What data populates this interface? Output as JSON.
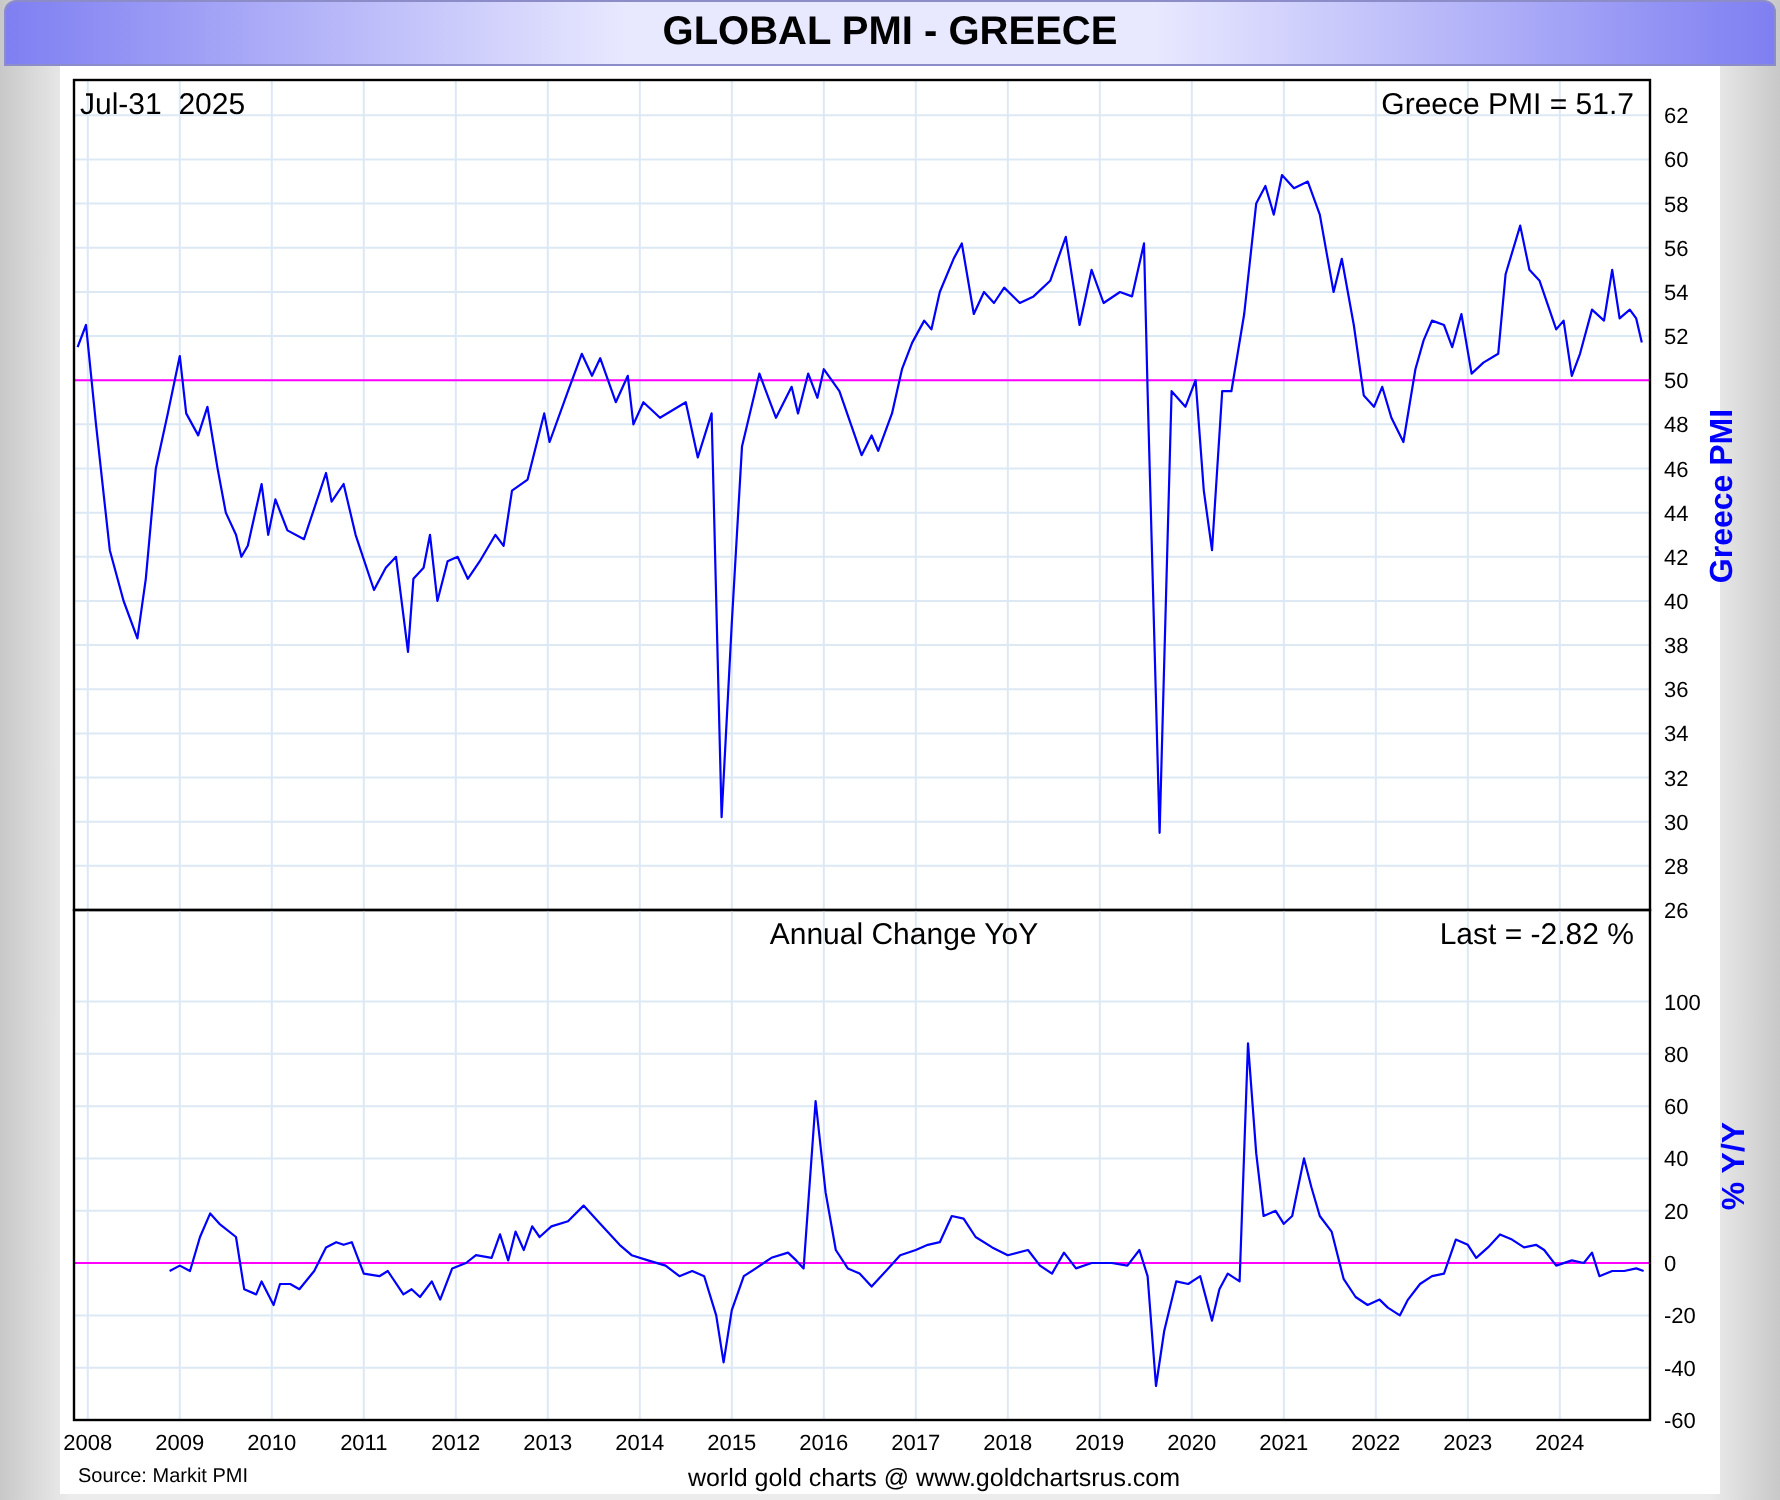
{
  "title": "GLOBAL PMI - GREECE",
  "date": "Jul-31  2025",
  "panels": [
    {
      "reading": "Greece PMI = 51.7",
      "chart_data": {
        "type": "line",
        "ylabel": "Greece PMI",
        "xlim": [
          2007.85,
          2024.98
        ],
        "ylim": [
          26,
          63.6
        ],
        "yticks": [
          26,
          28,
          30,
          32,
          34,
          36,
          38,
          40,
          42,
          44,
          46,
          48,
          50,
          52,
          54,
          56,
          58,
          60,
          62
        ],
        "grid": true,
        "ref_lines": [
          {
            "axis": "y",
            "value": 50,
            "color": "#ff00ff"
          }
        ],
        "x": [
          2007.89,
          2007.98,
          2008.09,
          2008.24,
          2008.39,
          2008.54,
          2008.63,
          2008.74,
          2008.87,
          2009.0,
          2009.07,
          2009.2,
          2009.3,
          2009.41,
          2009.5,
          2009.61,
          2009.67,
          2009.74,
          2009.89,
          2009.96,
          2010.04,
          2010.17,
          2010.35,
          2010.59,
          2010.65,
          2010.78,
          2010.91,
          2011.11,
          2011.24,
          2011.35,
          2011.48,
          2011.54,
          2011.65,
          2011.72,
          2011.8,
          2011.91,
          2012.02,
          2012.13,
          2012.26,
          2012.43,
          2012.52,
          2012.61,
          2012.78,
          2012.96,
          2013.02,
          2013.22,
          2013.37,
          2013.48,
          2013.57,
          2013.74,
          2013.87,
          2013.93,
          2014.04,
          2014.22,
          2014.5,
          2014.63,
          2014.78,
          2014.89,
          2015.0,
          2015.11,
          2015.3,
          2015.48,
          2015.65,
          2015.72,
          2015.83,
          2015.93,
          2016.0,
          2016.17,
          2016.41,
          2016.52,
          2016.59,
          2016.74,
          2016.85,
          2016.96,
          2017.09,
          2017.17,
          2017.26,
          2017.41,
          2017.5,
          2017.63,
          2017.74,
          2017.85,
          2017.96,
          2018.13,
          2018.28,
          2018.46,
          2018.63,
          2018.78,
          2018.91,
          2019.04,
          2019.22,
          2019.35,
          2019.48,
          2019.52,
          2019.65,
          2019.78,
          2019.93,
          2020.04,
          2020.13,
          2020.22,
          2020.33,
          2020.43,
          2020.57,
          2020.7,
          2020.8,
          2020.89,
          2020.98,
          2021.11,
          2021.26,
          2021.39,
          2021.54,
          2021.63,
          2021.76,
          2021.87,
          2021.98,
          2022.07,
          2022.17,
          2022.3,
          2022.43,
          2022.52,
          2022.61,
          2022.74,
          2022.83,
          2022.93,
          2023.04,
          2023.17,
          2023.33,
          2023.41,
          2023.57,
          2023.67,
          2023.78,
          2023.96,
          2024.04,
          2024.13,
          2024.22,
          2024.35,
          2024.48,
          2024.57,
          2024.65,
          2024.76,
          2024.83,
          2024.89
        ],
        "series": [
          {
            "color": "#0000ff",
            "values": [
              51.5,
              52.5,
              48,
              42.3,
              40,
              38.3,
              41,
              46,
              48.5,
              51.1,
              48.5,
              47.5,
              48.8,
              46,
              44,
              43,
              42,
              42.5,
              45.3,
              43,
              44.6,
              43.2,
              42.8,
              45.8,
              44.5,
              45.3,
              43,
              40.5,
              41.5,
              42,
              37.7,
              41,
              41.5,
              43,
              40,
              41.8,
              42,
              41,
              41.8,
              43,
              42.5,
              45,
              45.5,
              48.5,
              47.2,
              49.5,
              51.2,
              50.2,
              51,
              49,
              50.2,
              48,
              49,
              48.3,
              49,
              46.5,
              48.5,
              30.2,
              39,
              47,
              50.3,
              48.3,
              49.7,
              48.5,
              50.3,
              49.2,
              50.5,
              49.5,
              46.6,
              47.5,
              46.8,
              48.5,
              50.5,
              51.7,
              52.7,
              52.3,
              54,
              55.5,
              56.2,
              53,
              54,
              53.5,
              54.2,
              53.5,
              53.8,
              54.5,
              56.5,
              52.5,
              55,
              53.5,
              54,
              53.8,
              56.2,
              49.5,
              29.5,
              49.5,
              48.8,
              50,
              45,
              42.3,
              49.5,
              49.5,
              53,
              58,
              58.8,
              57.5,
              59.3,
              58.7,
              59,
              57.5,
              54,
              55.5,
              52.5,
              49.3,
              48.8,
              49.7,
              48.3,
              47.2,
              50.5,
              51.8,
              52.7,
              52.5,
              51.5,
              53,
              50.3,
              50.8,
              51.2,
              54.8,
              57,
              55,
              54.5,
              52.3,
              52.7,
              50.2,
              51.2,
              53.2,
              52.7,
              55,
              52.8,
              53.2,
              52.8,
              51.7
            ]
          }
        ]
      }
    },
    {
      "reading": "Last = -2.82 %",
      "chart_data": {
        "type": "line",
        "title": "Annual Change YoY",
        "ylabel": "% Y/Y",
        "xlim": [
          2007.85,
          2024.98
        ],
        "ylim": [
          -60,
          135
        ],
        "yticks": [
          -60,
          -40,
          -20,
          0,
          20,
          40,
          60,
          80,
          100
        ],
        "xticks": [
          2008,
          2009,
          2010,
          2011,
          2012,
          2013,
          2014,
          2015,
          2016,
          2017,
          2018,
          2019,
          2020,
          2021,
          2022,
          2023,
          2024
        ],
        "grid": true,
        "ref_lines": [
          {
            "axis": "y",
            "value": 0,
            "color": "#ff00ff"
          }
        ],
        "x": [
          2008.89,
          2009.0,
          2009.11,
          2009.22,
          2009.33,
          2009.43,
          2009.61,
          2009.7,
          2009.83,
          2009.89,
          2010.02,
          2010.09,
          2010.2,
          2010.3,
          2010.46,
          2010.59,
          2010.7,
          2010.78,
          2010.87,
          2011.0,
          2011.17,
          2011.26,
          2011.43,
          2011.52,
          2011.61,
          2011.74,
          2011.83,
          2011.96,
          2012.11,
          2012.22,
          2012.39,
          2012.48,
          2012.57,
          2012.65,
          2012.74,
          2012.83,
          2012.91,
          2013.04,
          2013.22,
          2013.39,
          2013.57,
          2013.78,
          2013.91,
          2014.09,
          2014.28,
          2014.43,
          2014.57,
          2014.7,
          2014.83,
          2014.91,
          2015.0,
          2015.13,
          2015.26,
          2015.43,
          2015.61,
          2015.7,
          2015.78,
          2015.91,
          2016.02,
          2016.13,
          2016.26,
          2016.39,
          2016.52,
          2016.65,
          2016.83,
          2017.0,
          2017.13,
          2017.26,
          2017.39,
          2017.52,
          2017.65,
          2017.83,
          2018.0,
          2018.22,
          2018.35,
          2018.48,
          2018.61,
          2018.74,
          2018.91,
          2019.13,
          2019.3,
          2019.43,
          2019.52,
          2019.61,
          2019.7,
          2019.83,
          2019.96,
          2020.09,
          2020.22,
          2020.3,
          2020.39,
          2020.52,
          2020.61,
          2020.7,
          2020.78,
          2020.91,
          2021.0,
          2021.09,
          2021.22,
          2021.3,
          2021.39,
          2021.52,
          2021.65,
          2021.78,
          2021.91,
          2022.04,
          2022.13,
          2022.26,
          2022.35,
          2022.48,
          2022.61,
          2022.74,
          2022.87,
          2023.0,
          2023.09,
          2023.22,
          2023.35,
          2023.48,
          2023.61,
          2023.74,
          2023.83,
          2023.96,
          2024.13,
          2024.26,
          2024.35,
          2024.43,
          2024.57,
          2024.7,
          2024.83,
          2024.91
        ],
        "series": [
          {
            "color": "#0000ff",
            "values": [
              -3,
              -1,
              -3,
              10,
              19,
              15,
              10,
              -10,
              -12,
              -7,
              -16,
              -8,
              -8,
              -10,
              -3,
              6,
              8,
              7,
              8,
              -4,
              -5,
              -3,
              -12,
              -10,
              -13,
              -7,
              -14,
              -2,
              0,
              3,
              2,
              11,
              1,
              12,
              5,
              14,
              10,
              14,
              16,
              22,
              15,
              7,
              3,
              1,
              -1,
              -5,
              -3,
              -5,
              -20,
              -38,
              -18,
              -5,
              -2,
              2,
              4,
              1,
              -2,
              62,
              27,
              5,
              -2,
              -4,
              -9,
              -4,
              3,
              5,
              7,
              8,
              18,
              17,
              10,
              6,
              3,
              5,
              -1,
              -4,
              4,
              -2,
              0,
              0,
              -1,
              5,
              -5,
              -47,
              -26,
              -7,
              -8,
              -5,
              -22,
              -10,
              -4,
              -7,
              84,
              42,
              18,
              20,
              15,
              18,
              40,
              29,
              18,
              12,
              -6,
              -13,
              -16,
              -14,
              -17,
              -20,
              -14,
              -8,
              -5,
              -4,
              9,
              7,
              2,
              6,
              11,
              9,
              6,
              7,
              5,
              -1,
              1,
              0,
              4,
              -5,
              -3,
              -3,
              -2,
              -3
            ]
          }
        ]
      }
    }
  ],
  "source": "Source: Markit PMI",
  "credit": "world gold charts @ www.goldchartsrus.com"
}
